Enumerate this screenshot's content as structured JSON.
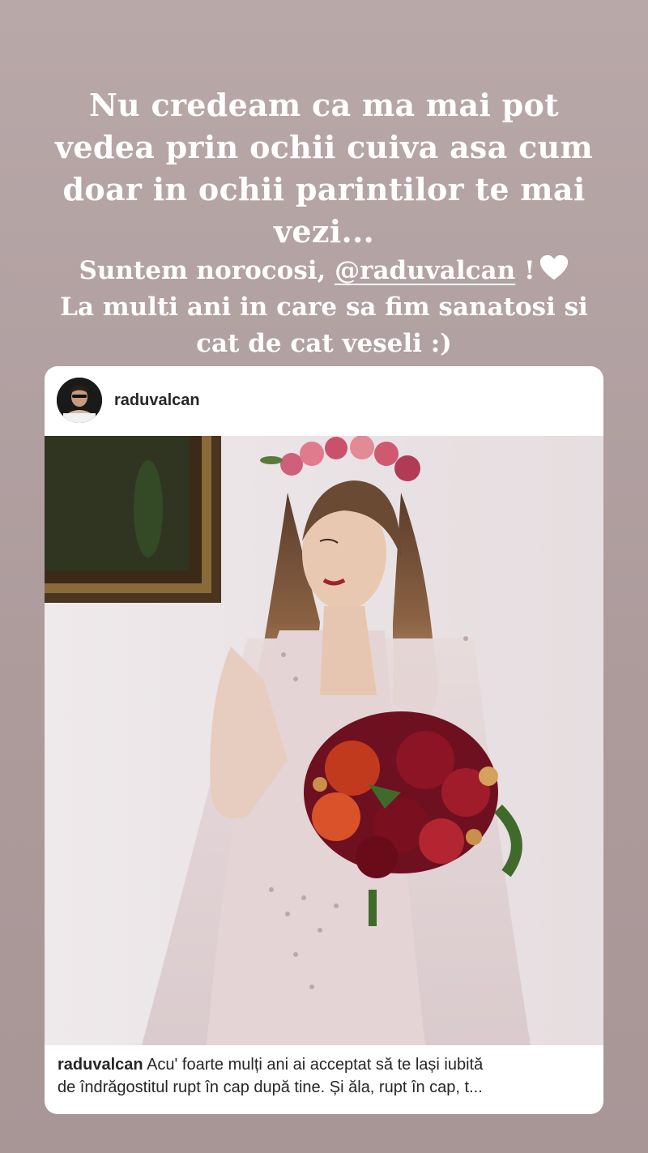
{
  "story": {
    "quote_lines": [
      "Nu credeam ca ma mai pot",
      "vedea prin ochii cuiva asa cum",
      "doar in ochii parintilor te mai",
      "vezi..."
    ],
    "message_prefix": "Suntem norocosi, ",
    "mention": "@raduvalcan",
    "message_suffix": " !",
    "heart_icon": "white-heart-emoji",
    "message_line2": "La multi ani in care sa fim sanatosi si",
    "message_line3": "cat de cat veseli :)"
  },
  "post": {
    "username": "raduvalcan",
    "caption_user": "raduvalcan",
    "caption_line1": " Acu' foarte mulți ani ai acceptat să te lași iubită",
    "caption_line2": "de îndrăgostitul rupt în cap după tine. Și ăla, rupt în cap, t..."
  },
  "colors": {
    "background": "#b2a1a2",
    "text": "#ffffff",
    "card": "#ffffff"
  }
}
